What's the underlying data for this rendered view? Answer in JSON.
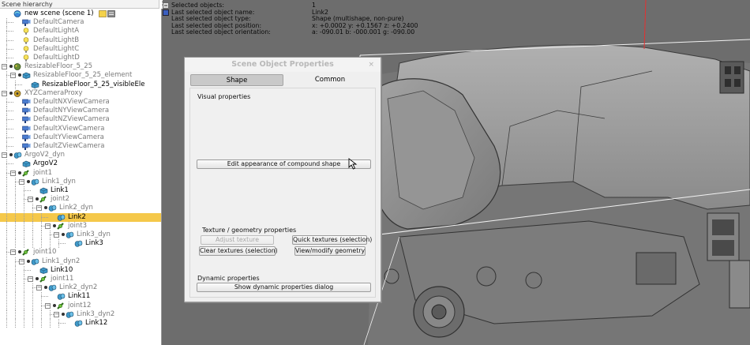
{
  "hierarchy": {
    "header": "Scene hierarchy",
    "close": "×",
    "items": [
      {
        "label": "new scene (scene 1)",
        "style": "blk"
      },
      {
        "label": "DefaultCamera",
        "style": "dim"
      },
      {
        "label": "DefaultLightA",
        "style": "dim"
      },
      {
        "label": "DefaultLightB",
        "style": "dim"
      },
      {
        "label": "DefaultLightC",
        "style": "dim"
      },
      {
        "label": "DefaultLightD",
        "style": "dim"
      },
      {
        "label": "ResizableFloor_5_25",
        "style": "dim"
      },
      {
        "label": "ResizableFloor_5_25_element",
        "style": "dim"
      },
      {
        "label": "ResizableFloor_5_25_visibleEle",
        "style": "blk"
      },
      {
        "label": "XYZCameraProxy",
        "style": "dim"
      },
      {
        "label": "DefaultNXViewCamera",
        "style": "dim"
      },
      {
        "label": "DefaultNYViewCamera",
        "style": "dim"
      },
      {
        "label": "DefaultNZViewCamera",
        "style": "dim"
      },
      {
        "label": "DefaultXViewCamera",
        "style": "dim"
      },
      {
        "label": "DefaultYViewCamera",
        "style": "dim"
      },
      {
        "label": "DefaultZViewCamera",
        "style": "dim"
      },
      {
        "label": "ArgoV2_dyn",
        "style": "dim"
      },
      {
        "label": "ArgoV2",
        "style": "blk"
      },
      {
        "label": "joint1",
        "style": "dim"
      },
      {
        "label": "Link1_dyn",
        "style": "dim"
      },
      {
        "label": "Link1",
        "style": "blk"
      },
      {
        "label": "joint2",
        "style": "dim"
      },
      {
        "label": "Link2_dyn",
        "style": "dim"
      },
      {
        "label": "Link2",
        "style": "blk"
      },
      {
        "label": "joint3",
        "style": "dim"
      },
      {
        "label": "Link3_dyn",
        "style": "dim"
      },
      {
        "label": "Link3",
        "style": "blk"
      },
      {
        "label": "joint10",
        "style": "dim"
      },
      {
        "label": "Link1_dyn2",
        "style": "dim"
      },
      {
        "label": "Link10",
        "style": "blk"
      },
      {
        "label": "joint11",
        "style": "dim"
      },
      {
        "label": "Link2_dyn2",
        "style": "dim"
      },
      {
        "label": "Link11",
        "style": "blk"
      },
      {
        "label": "joint12",
        "style": "dim"
      },
      {
        "label": "Link3_dyn2",
        "style": "dim"
      },
      {
        "label": "Link12",
        "style": "blk"
      }
    ],
    "selected_item": "Link2"
  },
  "info": {
    "rows": [
      {
        "label": "Selected objects:",
        "value": "1"
      },
      {
        "label": "Last selected object name:",
        "value": "Link2"
      },
      {
        "label": "Last selected object type:",
        "value": "Shape (multishape, non-pure)"
      },
      {
        "label": "Last selected object position:",
        "value": "x: +0.0002   y: +0.1567   z: +0.2400"
      },
      {
        "label": "Last selected object orientation:",
        "value": "a: -090.01   b: -000.001   g: -090.00"
      }
    ]
  },
  "dialog": {
    "title": "Scene Object Properties",
    "close": "×",
    "tabs": [
      "Shape",
      "Common"
    ],
    "active_tab": "Shape",
    "visual_heading": "Visual properties",
    "edit_appearance": "Edit appearance of compound shape",
    "texture_heading": "Texture / geometry properties",
    "adjust_texture": "Adjust texture",
    "quick_textures": "Quick textures (selection)",
    "clear_textures": "Clear textures (selection)",
    "view_geometry": "View/modify geometry",
    "dynamic_heading": "Dynamic properties",
    "show_dynamic": "Show dynamic properties dialog"
  },
  "colors": {
    "selection": "#f5c84a",
    "viewport_bg": "#6e6e6e",
    "robot_body": "#8f8f8f"
  }
}
